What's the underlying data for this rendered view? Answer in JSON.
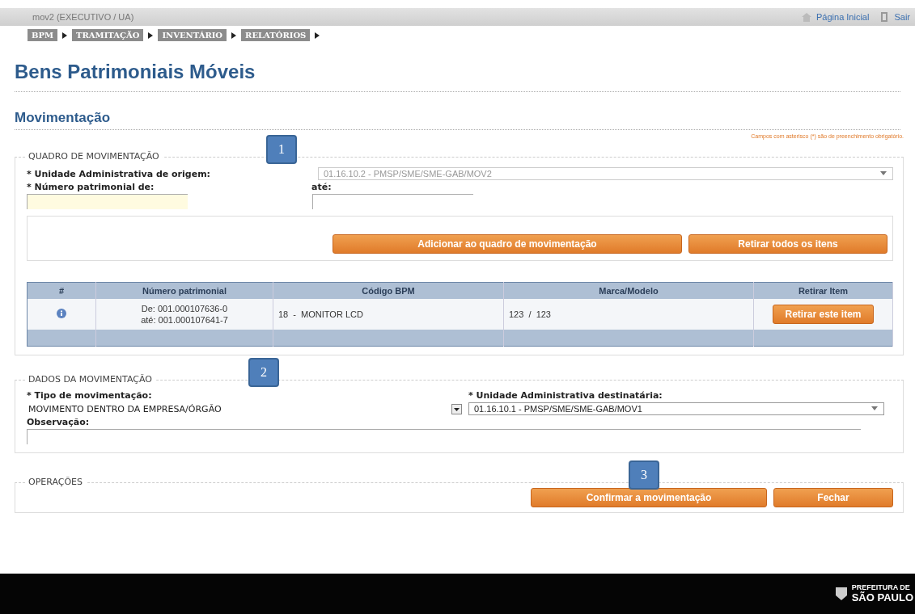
{
  "topbar": {
    "user": "mov2 (EXECUTIVO / UA)",
    "links": [
      {
        "kind": "home",
        "label": "Página Inicial"
      },
      {
        "kind": "exit",
        "label": "Sair"
      }
    ]
  },
  "breadcrumb": [
    "BPM",
    "TRAMITAÇÃO",
    "INVENTÁRIO",
    "RELATÓRIOS"
  ],
  "page_title": "Bens Patrimoniais Móveis",
  "section_title": "Movimentação",
  "required_note": "Campos com asterisco (*) são de preenchimento obrigatório.",
  "quadro": {
    "legend": "QUADRO DE MOVIMENTAÇÃO",
    "callout": "1",
    "origin_label": "* Unidade Administrativa de origem:",
    "origin_value": "01.16.10.2 - PMSP/SME/SME-GAB/MOV2",
    "origin_disabled": true,
    "from_label": "* Número patrimonial de:",
    "to_label": "até:",
    "buttons": [
      "Adicionar ao quadro de movimentação",
      "Retirar todos os itens"
    ],
    "table": {
      "columns": [
        "#",
        "Número patrimonial",
        "Código BPM",
        "Marca/Modelo",
        "Retirar Item"
      ],
      "rows": [
        {
          "number_from": "De: 001.000107636-0",
          "number_to": "até: 001.000107641-7",
          "code": "18  -  MONITOR LCD",
          "brand": "123  /  123",
          "action": "Retirar este item"
        }
      ]
    }
  },
  "dados": {
    "legend": "DADOS DA MOVIMENTAÇÃO",
    "callout": "2",
    "type_label": "* Tipo de movimentação:",
    "type_value": "MOVIMENTO DENTRO DA EMPRESA/ÓRGÃO",
    "dest_label": "* Unidade Administrativa destinatária:",
    "dest_value": "01.16.10.1 - PMSP/SME/SME-GAB/MOV1",
    "obs_label": "Observação:"
  },
  "operacoes": {
    "legend": "OPERAÇÕES",
    "callout": "3",
    "buttons": [
      "Confirmar a movimentação",
      "Fechar"
    ]
  },
  "footer": {
    "logo_top": "PREFEITURA DE",
    "logo_bottom": "SÃO PAULO"
  }
}
